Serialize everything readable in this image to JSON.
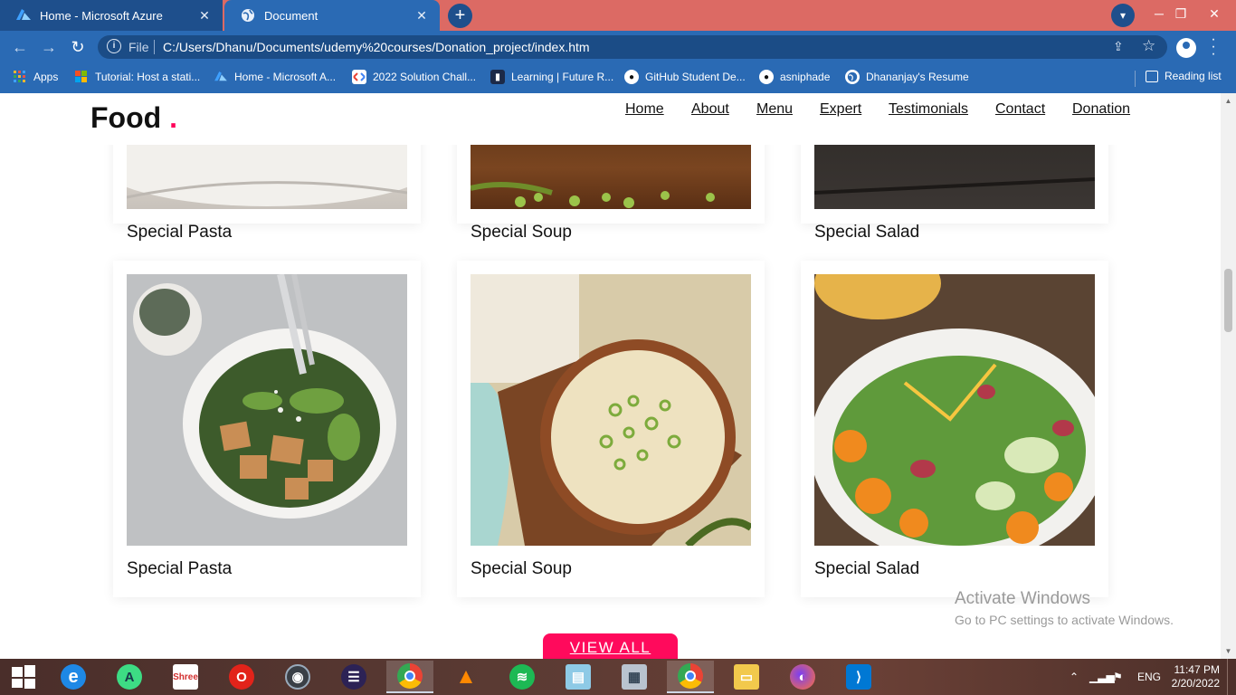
{
  "browser": {
    "tabs": [
      {
        "title": "Home - Microsoft Azure",
        "icon": "azure-icon"
      },
      {
        "title": "Document",
        "icon": "globe-icon"
      }
    ],
    "omnibox": {
      "scheme_label": "File",
      "url": "C:/Users/Dhanu/Documents/udemy%20courses/Donation_project/index.htm"
    },
    "bookmarks": [
      {
        "label": "Apps",
        "icon": "apps-grid-icon"
      },
      {
        "label": "Tutorial: Host a stati...",
        "icon": "windows-logo-icon"
      },
      {
        "label": "Home - Microsoft A...",
        "icon": "azure-icon"
      },
      {
        "label": "2022 Solution Chall...",
        "icon": "google-dev-icon"
      },
      {
        "label": "Learning | Future R...",
        "icon": "learning-icon"
      },
      {
        "label": "GitHub Student De...",
        "icon": "github-icon"
      },
      {
        "label": "asniphade",
        "icon": "github-icon"
      },
      {
        "label": "Dhananjay's Resume",
        "icon": "globe-icon"
      }
    ],
    "reading_list": "Reading list"
  },
  "site": {
    "logo_text": "Food",
    "logo_dot": ".",
    "nav": [
      "Home",
      "About",
      "Menu",
      "Expert",
      "Testimonials",
      "Contact",
      "Donation"
    ],
    "cards_row1": [
      "Special Pasta",
      "Special Soup",
      "Special Salad"
    ],
    "cards_row2": [
      "Special Pasta",
      "Special Soup",
      "Special Salad"
    ],
    "view_all": "VIEW ALL"
  },
  "watermark": {
    "title": "Activate Windows",
    "subtitle": "Go to PC settings to activate Windows."
  },
  "taskbar": {
    "apps": [
      "windows-start-icon",
      "edge-icon",
      "android-studio-icon",
      "shree-icon",
      "opera-icon",
      "camera-icon",
      "eclipse-icon",
      "chrome-icon",
      "vlc-icon",
      "spotify-icon",
      "notepad-icon",
      "calculator-icon",
      "chrome-profile-icon",
      "file-explorer-icon",
      "firefox-icon",
      "vscode-icon"
    ],
    "language": "ENG",
    "time": "11:47 PM",
    "date": "2/20/2022"
  },
  "colors": {
    "accent": "#ff0a5c",
    "tabstrip": "#dc6a64",
    "toolbar": "#2a6ab4"
  }
}
